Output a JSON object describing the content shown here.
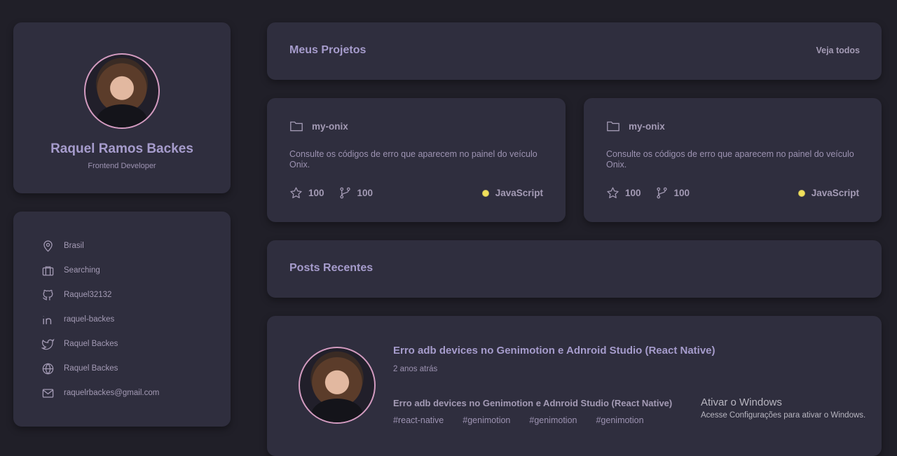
{
  "profile": {
    "name": "Raquel Ramos Backes",
    "role": "Frontend Developer"
  },
  "info": {
    "items": [
      {
        "icon": "location-pin-icon",
        "label": "Brasil"
      },
      {
        "icon": "briefcase-icon",
        "label": "Searching"
      },
      {
        "icon": "github-icon",
        "label": "Raquel32132"
      },
      {
        "icon": "linkedin-icon",
        "label": "raquel-backes"
      },
      {
        "icon": "twitter-icon",
        "label": "Raquel Backes"
      },
      {
        "icon": "globe-icon",
        "label": "Raquel Backes"
      },
      {
        "icon": "mail-icon",
        "label": "raquelrbackes@gmail.com"
      }
    ]
  },
  "projects_header": {
    "title": "Meus Projetos",
    "see_all": "Veja todos"
  },
  "projects": [
    {
      "name": "my-onix",
      "description": "Consulte os códigos de erro que aparecem no painel do veículo Onix.",
      "stars": "100",
      "forks": "100",
      "language": "JavaScript",
      "language_color": "#f1e05a"
    },
    {
      "name": "my-onix",
      "description": "Consulte os códigos de erro que aparecem no painel do veículo Onix.",
      "stars": "100",
      "forks": "100",
      "language": "JavaScript",
      "language_color": "#f1e05a"
    }
  ],
  "posts_header": {
    "title": "Posts Recentes"
  },
  "post": {
    "title": "Erro adb devices no Genimotion e Adnroid Studio (React Native)",
    "time": "2 anos atrás",
    "excerpt": "Erro adb devices no Genimotion e Adnroid Studio (React Native)",
    "tags": [
      "#react-native",
      "#genimotion",
      "#genimotion",
      "#genimotion"
    ]
  },
  "watermark": {
    "title": "Ativar o Windows",
    "subtitle": "Acesse Configurações para ativar o Windows."
  },
  "colors": {
    "background": "#201f28",
    "card": "#2f2e3e",
    "accent_text": "#a69ccc",
    "avatar_border": "#d39bc0",
    "javascript": "#f1e05a"
  }
}
